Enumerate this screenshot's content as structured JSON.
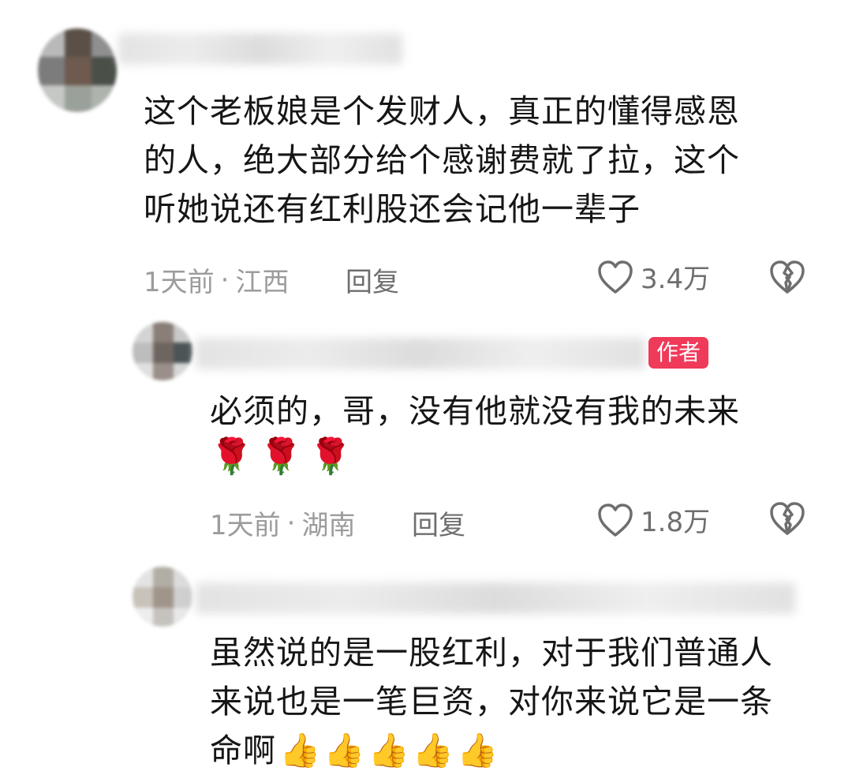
{
  "comments": [
    {
      "text_lines": [
        "这个老板娘是个发财人，真正的懂得感恩",
        "的人，绝大部分给个感谢费就了拉，这个",
        "听她说还有红利股还会记他一辈子"
      ],
      "time": "1天前",
      "sep": "·",
      "location": "江西",
      "reply": "回复",
      "likes": "3.4万"
    },
    {
      "badge": "作者",
      "text_lines": [
        "必须的，哥，没有他就没有我的未来"
      ],
      "emojis": "🌹🌹🌹",
      "time": "1天前",
      "sep": "·",
      "location": "湖南",
      "reply": "回复",
      "likes": "1.8万"
    },
    {
      "text_lines": [
        "虽然说的是一股红利，对于我们普通人",
        "来说也是一笔巨资，对你来说它是一条",
        "命啊"
      ],
      "emojis": "👍👍👍👍👍"
    }
  ],
  "icons": {
    "like": "heart-outline-icon",
    "dislike": "broken-heart-icon"
  },
  "colors": {
    "author_badge": "#f03a5a",
    "meta_text": "#9c9c9c"
  }
}
